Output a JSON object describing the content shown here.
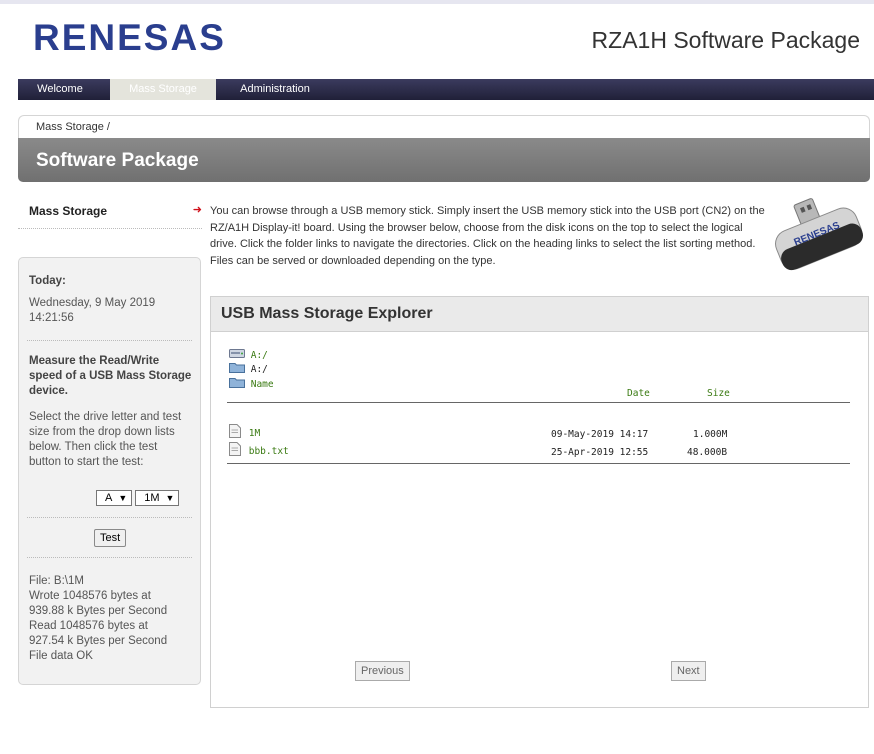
{
  "brand": {
    "logo_text": "RENESAS",
    "accent": "#2a3e8e"
  },
  "app_title": "RZA1H Software Package",
  "nav": {
    "tabs": [
      {
        "label": "Welcome",
        "active": false
      },
      {
        "label": "Mass Storage",
        "active": true
      },
      {
        "label": "Administration",
        "active": false
      }
    ]
  },
  "breadcrumb": "Mass Storage /",
  "section_title": "Software Package",
  "sidebar": {
    "menu_item": "Mass Storage",
    "today_label": "Today:",
    "today_date": "Wednesday, 9 May 2019",
    "today_time": "14:21:56",
    "measure_title": "Measure the Read/Write speed of a USB Mass Storage device.",
    "measure_desc": "Select the drive letter and test size from the drop down lists below. Then click the test button to start the test:",
    "drive_select": "A",
    "size_select": "1M",
    "test_button": "Test",
    "result_lines": [
      "File: B:\\1M",
      "Wrote 1048576 bytes at",
      "939.88 k Bytes per Second",
      "Read 1048576 bytes at",
      "927.54 k Bytes per Second",
      "File data OK"
    ]
  },
  "intro_text": "You can browse through a USB memory stick. Simply insert the USB memory stick into the USB port (CN2) on the RZ/A1H Display-it! board. Using the browser below, choose from the disk icons on the top to select the logical drive. Click the folder links to navigate the directories. Click on the heading links to select the list sorting method. Files can be served or downloaded depending on the type.",
  "usb_stick_text": "RENESAS",
  "explorer": {
    "title": "USB Mass Storage Explorer",
    "drive_link": "A:/",
    "path": "A:/",
    "headers": {
      "name": "Name",
      "date": "Date",
      "size": "Size"
    },
    "files": [
      {
        "name": "1M",
        "date": "09-May-2019 14:17",
        "size": "1.000M"
      },
      {
        "name": "bbb.txt",
        "date": "25-Apr-2019 12:55",
        "size": "48.000B"
      }
    ],
    "prev_button": "Previous",
    "next_button": "Next"
  }
}
